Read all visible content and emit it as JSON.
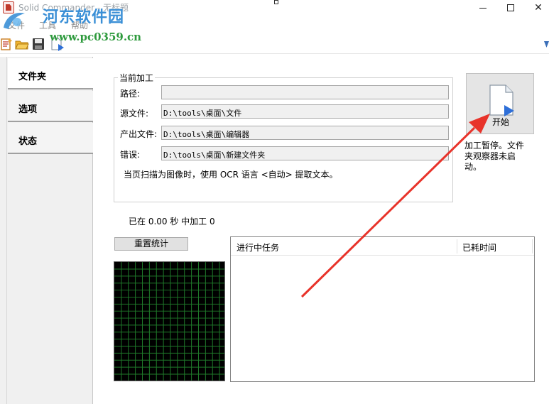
{
  "window": {
    "title": "Solid Commander - 无标题",
    "minimize_glyph": "",
    "close_glyph": "✕"
  },
  "watermark": {
    "title": "河东软件园",
    "url": "www.pc0359.cn"
  },
  "menu": {
    "file": "文件",
    "tools": "工具",
    "help": "帮助"
  },
  "toolbar": {
    "icons": [
      "new-document-icon",
      "open-folder-icon",
      "save-icon",
      "run-icon"
    ]
  },
  "nav": {
    "folder": "文件夹",
    "options": "选项",
    "status": "状态"
  },
  "current_group": {
    "legend": "当前加工",
    "path_label": "路径:",
    "path_value": "",
    "source_label": "源文件:",
    "source_value": "D:\\tools\\桌面\\文件",
    "output_label": "产出文件:",
    "output_value": "D:\\tools\\桌面\\编辑器",
    "error_label": "错误:",
    "error_value": "D:\\tools\\桌面\\新建文件夹",
    "ocr_note": "当页扫描为图像时，使用 OCR 语言 <自动> 提取文本。"
  },
  "elapsed": "已在 0.00 秒 中加工 0",
  "start_button": {
    "label": "开始"
  },
  "status_note": "加工暂停。文件夹观察器未启动。",
  "reset_button": "重置统计",
  "task_list": {
    "col_task": "进行中任务",
    "col_time": "已耗时间"
  },
  "colors": {
    "annotation_arrow": "#e8332a",
    "graph_grid": "#1f7a2a",
    "graph_bg": "#000000",
    "watermark_title": "#3a8fd6",
    "watermark_url": "#2e9a3d"
  }
}
